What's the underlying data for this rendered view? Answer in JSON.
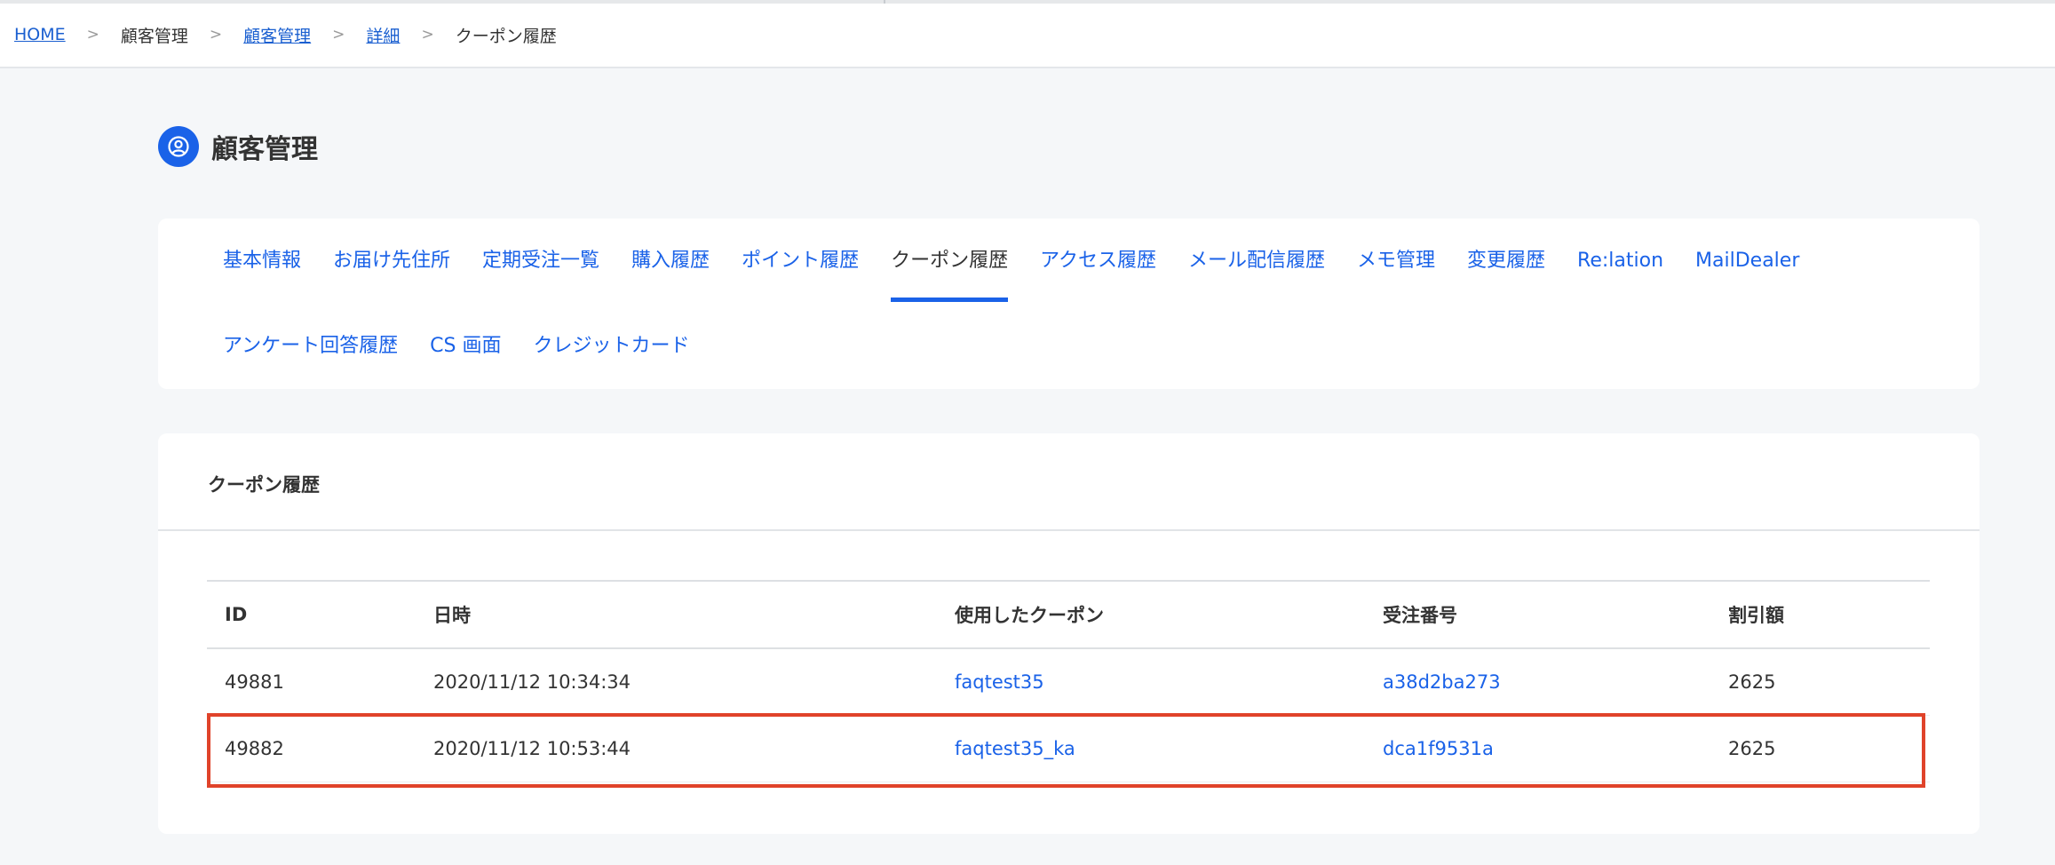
{
  "breadcrumb": {
    "items": [
      {
        "label": "HOME",
        "link": true
      },
      {
        "label": "顧客管理",
        "link": false
      },
      {
        "label": "顧客管理",
        "link": true
      },
      {
        "label": "詳細",
        "link": true
      },
      {
        "label": "クーポン履歴",
        "link": false
      }
    ],
    "separator": ">"
  },
  "page": {
    "title": "顧客管理",
    "icon": "user-circle-icon"
  },
  "tabs": {
    "row1": [
      "基本情報",
      "お届け先住所",
      "定期受注一覧",
      "購入履歴",
      "ポイント履歴",
      "クーポン履歴",
      "アクセス履歴",
      "メール配信履歴",
      "メモ管理",
      "変更履歴",
      "Re:lation",
      "MailDealer"
    ],
    "row2": [
      "アンケート回答履歴",
      "CS 画面",
      "クレジットカード"
    ],
    "active": "クーポン履歴"
  },
  "section": {
    "title": "クーポン履歴"
  },
  "table": {
    "headers": [
      "ID",
      "日時",
      "使用したクーポン",
      "受注番号",
      "割引額"
    ],
    "rows": [
      {
        "id": "49881",
        "datetime": "2020/11/12 10:34:34",
        "coupon": "faqtest35",
        "order": "a38d2ba273",
        "amount": "2625"
      },
      {
        "id": "49882",
        "datetime": "2020/11/12 10:53:44",
        "coupon": "faqtest35_ka",
        "order": "dca1f9531a",
        "amount": "2625"
      }
    ]
  },
  "colors": {
    "accent": "#1a62e8",
    "highlight": "#e0432a",
    "background": "#f5f7f9"
  }
}
